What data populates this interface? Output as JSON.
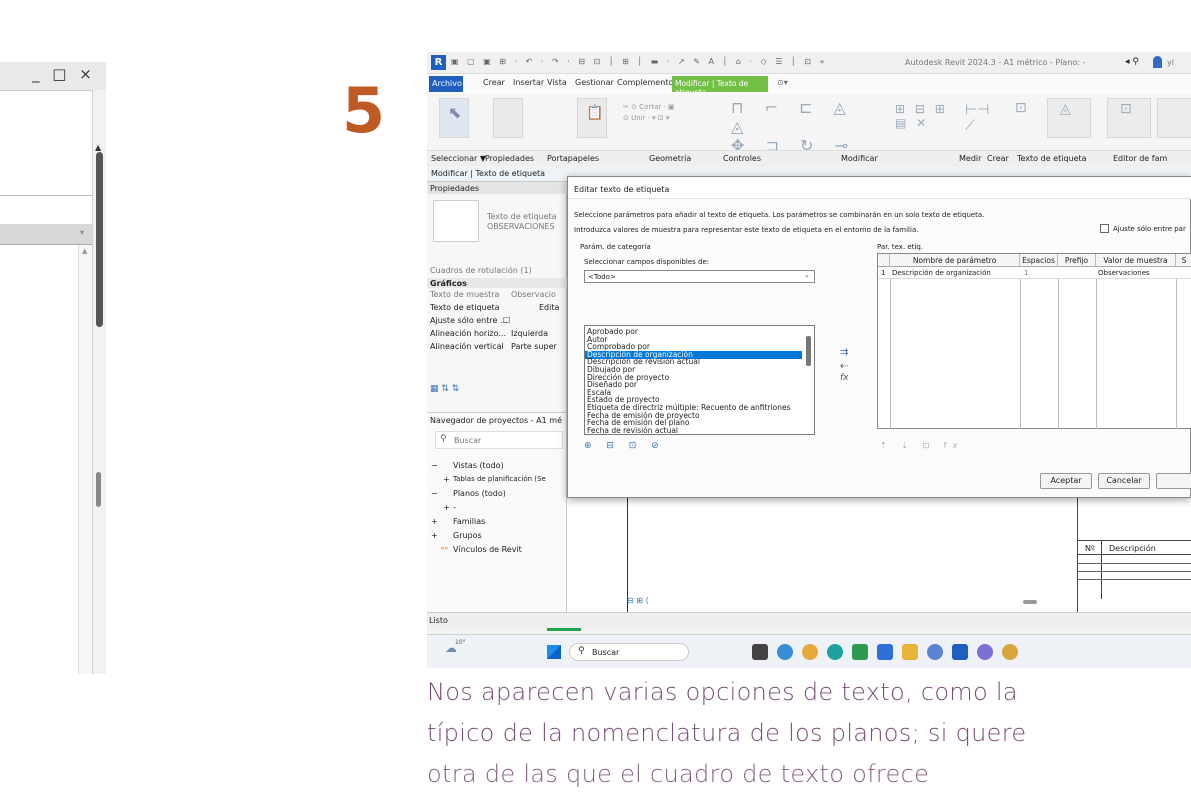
{
  "left_window": {
    "controls": "_ □ ×"
  },
  "step": {
    "number": "5"
  },
  "app": {
    "title": "Autodesk Revit 2024.3 - A1 métrico - Plano: -",
    "search_icon": "binoculars-icon",
    "user": "yi"
  },
  "menu": [
    "Archivo",
    "Crear",
    "Insertar",
    "Vista",
    "Gestionar",
    "Complementos",
    "Modificar | Texto de etiqueta"
  ],
  "ribbon": {
    "groups": [
      "Seleccionar ▼",
      "Propiedades",
      "Portapapeles",
      "Geometría",
      "Controles",
      "Modificar",
      "Medir",
      "Crear",
      "Texto de etiqueta",
      "Editor de fam"
    ],
    "buttons": [
      "Modificar",
      "Pegar",
      "Cortar",
      "Unir",
      "Editar texto de etiqueta",
      "Cargar en proyecto"
    ]
  },
  "context_bar": "Modificar | Texto de etiqueta",
  "properties": {
    "header": "Propiedades",
    "type_name": "Texto de etiqueta",
    "type_value": "OBSERVACIONES",
    "selector": "Cuadros de rotulación (1)",
    "section": "Gráficos",
    "rows": [
      {
        "label": "Texto de muestra",
        "value": "Observacio"
      },
      {
        "label": "Texto de etiqueta",
        "value": "Edita"
      },
      {
        "label": "Ajuste sólo entre ...",
        "value": "☐"
      },
      {
        "label": "Alineación horizo...",
        "value": "Izquierda"
      },
      {
        "label": "Alineación vertical",
        "value": "Parte super"
      }
    ]
  },
  "navigator": {
    "header": "Navegador de proyectos - A1 mé",
    "search_placeholder": "Buscar",
    "items": [
      {
        "prefix": "−",
        "label": "Vistas (todo)"
      },
      {
        "prefix": "+",
        "label": "Tablas de planificación (Se"
      },
      {
        "prefix": "−",
        "label": "Planos (todo)"
      },
      {
        "prefix": "+",
        "label": "-"
      },
      {
        "prefix": "+",
        "label": "Familias"
      },
      {
        "prefix": "+",
        "label": "Grupos"
      },
      {
        "prefix": "",
        "label": "Vínculos de Revit"
      }
    ]
  },
  "status": "Listo",
  "dialog": {
    "title": "Editar texto de etiqueta",
    "instruction1": "Seleccione parámetros para añadir al texto de etiqueta. Los parámetros se combinarán en un solo texto de etiqueta.",
    "instruction2": "Introduzca valores de muestra para representar este texto de etiqueta en el entorno de la familia.",
    "checkbox_label": "Ajuste sólo entre par",
    "category_params_label": "Parám. de categoría",
    "select_fields_label": "Seleccionar campos disponibles de:",
    "select_value": "<Todo>",
    "list_items": [
      "Aprobado por",
      "Autor",
      "Comprobado por",
      "Descripción de organización",
      "Descripción de revisión actual",
      "Dibujado por",
      "Dirección de proyecto",
      "Diseñado por",
      "Escala",
      "Estado de proyecto",
      "Etiqueta de directriz múltiple: Recuento de anfitriones",
      "Fecha de emisión de proyecto",
      "Fecha de emisión del plano",
      "Fecha de revisión actual"
    ],
    "selected_index": 3,
    "label_params_label": "Par. tex. etiq.",
    "grid_headers": [
      "Nombre de parámetro",
      "Espacios",
      "Prefijo",
      "Valor de muestra",
      "S"
    ],
    "grid_row": {
      "num": "1",
      "name": "Descripción de organización",
      "spaces": "1",
      "prefix": "",
      "sample": "Observaciones"
    },
    "ok_label": "Aceptar",
    "cancel_label": "Cancelar"
  },
  "title_block": {
    "col1": "Nº",
    "col2": "Descripción"
  },
  "taskbar": {
    "weather": "10°",
    "search": "Buscar"
  },
  "caption": {
    "line1": "Nos aparecen varias opciones de texto, como la",
    "line2": "típico de la nomenclatura de los planos; si quere",
    "line3": "otra de las que el cuadro de texto ofrece"
  }
}
